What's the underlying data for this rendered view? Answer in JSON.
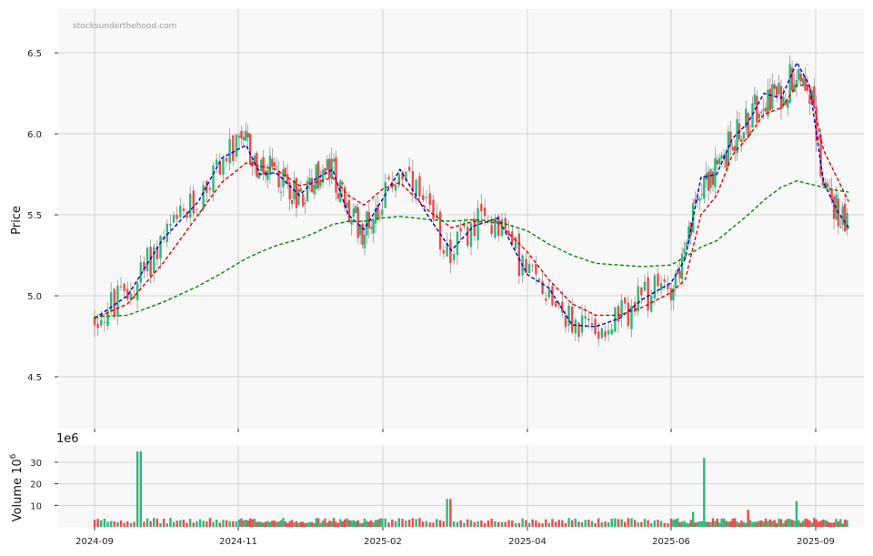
{
  "watermark": "stocksunderthehood.com",
  "chart_data": [
    {
      "type": "candlestick",
      "ylabel": "Price",
      "ylim": [
        4.18,
        6.77
      ],
      "yticks": [
        4.5,
        5.0,
        5.5,
        6.0,
        6.5
      ],
      "ytick_labels": [
        "4.5",
        "5.0",
        "5.5",
        "6.0",
        "6.5"
      ],
      "grid": true,
      "up_color": "#2db87a",
      "down_color": "#ef4a4a",
      "series": [
        {
          "style": "dashed",
          "color": "#0000cc",
          "points": [
            [
              "2024-09-01",
              4.86
            ],
            [
              "2024-09-15",
              5.0
            ],
            [
              "2024-09-30",
              5.35
            ],
            [
              "2024-10-15",
              5.58
            ],
            [
              "2024-10-25",
              5.85
            ],
            [
              "2024-11-06",
              5.93
            ],
            [
              "2024-11-15",
              5.75
            ],
            [
              "2024-11-25",
              5.76
            ],
            [
              "2024-12-10",
              5.62
            ],
            [
              "2024-12-20",
              5.72
            ],
            [
              "2024-12-31",
              5.78
            ],
            [
              "2025-01-10",
              5.5
            ],
            [
              "2025-01-20",
              5.41
            ],
            [
              "2025-02-01",
              5.6
            ],
            [
              "2025-02-08",
              5.78
            ],
            [
              "2025-02-20",
              5.48
            ],
            [
              "2025-03-01",
              5.28
            ],
            [
              "2025-03-10",
              5.43
            ],
            [
              "2025-03-20",
              5.48
            ],
            [
              "2025-04-01",
              5.13
            ],
            [
              "2025-04-10",
              5.05
            ],
            [
              "2025-04-20",
              4.82
            ],
            [
              "2025-04-30",
              4.81
            ],
            [
              "2025-05-10",
              4.86
            ],
            [
              "2025-05-20",
              4.98
            ],
            [
              "2025-06-01",
              5.08
            ],
            [
              "2025-06-10",
              5.23
            ],
            [
              "2025-06-20",
              5.73
            ],
            [
              "2025-06-30",
              5.75
            ],
            [
              "2025-07-10",
              5.97
            ],
            [
              "2025-07-20",
              6.07
            ],
            [
              "2025-07-30",
              6.25
            ],
            [
              "2025-08-10",
              6.22
            ],
            [
              "2025-08-20",
              6.44
            ],
            [
              "2025-08-28",
              6.3
            ],
            [
              "2025-09-06",
              5.7
            ],
            [
              "2025-09-15",
              5.52
            ],
            [
              "2025-09-22",
              5.42
            ]
          ]
        },
        {
          "style": "dashed",
          "color": "#e00000",
          "points": [
            [
              "2024-09-01",
              4.86
            ],
            [
              "2024-09-15",
              4.95
            ],
            [
              "2024-09-30",
              5.2
            ],
            [
              "2024-10-15",
              5.5
            ],
            [
              "2024-10-25",
              5.7
            ],
            [
              "2024-11-06",
              5.82
            ],
            [
              "2024-11-15",
              5.8
            ],
            [
              "2024-11-25",
              5.78
            ],
            [
              "2024-12-10",
              5.68
            ],
            [
              "2024-12-20",
              5.7
            ],
            [
              "2024-12-31",
              5.73
            ],
            [
              "2025-01-10",
              5.62
            ],
            [
              "2025-01-20",
              5.56
            ],
            [
              "2025-02-01",
              5.66
            ],
            [
              "2025-02-08",
              5.7
            ],
            [
              "2025-02-20",
              5.52
            ],
            [
              "2025-03-01",
              5.42
            ],
            [
              "2025-03-10",
              5.46
            ],
            [
              "2025-03-20",
              5.45
            ],
            [
              "2025-04-01",
              5.27
            ],
            [
              "2025-04-10",
              5.1
            ],
            [
              "2025-04-20",
              4.95
            ],
            [
              "2025-04-30",
              4.88
            ],
            [
              "2025-05-10",
              4.88
            ],
            [
              "2025-05-20",
              4.93
            ],
            [
              "2025-06-01",
              5.02
            ],
            [
              "2025-06-10",
              5.1
            ],
            [
              "2025-06-20",
              5.5
            ],
            [
              "2025-06-30",
              5.62
            ],
            [
              "2025-07-10",
              5.87
            ],
            [
              "2025-07-20",
              5.98
            ],
            [
              "2025-07-30",
              6.12
            ],
            [
              "2025-08-10",
              6.16
            ],
            [
              "2025-08-20",
              6.3
            ],
            [
              "2025-08-28",
              6.3
            ],
            [
              "2025-09-06",
              5.9
            ],
            [
              "2025-09-15",
              5.72
            ],
            [
              "2025-09-22",
              5.58
            ]
          ]
        },
        {
          "style": "dashed",
          "color": "#008800",
          "points": [
            [
              "2024-09-01",
              4.87
            ],
            [
              "2024-09-15",
              4.88
            ],
            [
              "2024-09-30",
              4.96
            ],
            [
              "2024-10-15",
              5.06
            ],
            [
              "2024-10-25",
              5.14
            ],
            [
              "2024-11-06",
              5.23
            ],
            [
              "2024-11-15",
              5.27
            ],
            [
              "2024-11-25",
              5.31
            ],
            [
              "2024-12-10",
              5.35
            ],
            [
              "2024-12-20",
              5.39
            ],
            [
              "2024-12-31",
              5.44
            ],
            [
              "2025-01-10",
              5.46
            ],
            [
              "2025-01-20",
              5.46
            ],
            [
              "2025-02-01",
              5.48
            ],
            [
              "2025-02-08",
              5.49
            ],
            [
              "2025-02-20",
              5.47
            ],
            [
              "2025-03-01",
              5.46
            ],
            [
              "2025-03-10",
              5.47
            ],
            [
              "2025-03-20",
              5.46
            ],
            [
              "2025-04-01",
              5.4
            ],
            [
              "2025-04-10",
              5.32
            ],
            [
              "2025-04-20",
              5.25
            ],
            [
              "2025-04-30",
              5.2
            ],
            [
              "2025-05-10",
              5.19
            ],
            [
              "2025-05-20",
              5.18
            ],
            [
              "2025-06-01",
              5.19
            ],
            [
              "2025-06-10",
              5.24
            ],
            [
              "2025-06-20",
              5.3
            ],
            [
              "2025-06-30",
              5.34
            ],
            [
              "2025-07-10",
              5.42
            ],
            [
              "2025-07-20",
              5.5
            ],
            [
              "2025-07-30",
              5.59
            ],
            [
              "2025-08-10",
              5.67
            ],
            [
              "2025-08-20",
              5.71
            ],
            [
              "2025-08-28",
              5.69
            ],
            [
              "2025-09-06",
              5.67
            ],
            [
              "2025-09-15",
              5.65
            ],
            [
              "2025-09-22",
              5.64
            ]
          ]
        }
      ]
    },
    {
      "type": "bar",
      "ylabel": "Volume  10",
      "ylabel_exponent": "6",
      "offset_label": "1e6",
      "ylim": [
        0,
        38
      ],
      "yticks": [
        10,
        20,
        30
      ],
      "ytick_labels": [
        "10",
        "20",
        "30"
      ],
      "grid": true,
      "up_color": "#2db87a",
      "down_color": "#ef4a4a",
      "spikes": [
        [
          "2024-09-20",
          35
        ],
        [
          "2025-02-28",
          13
        ],
        [
          "2025-06-15",
          7
        ],
        [
          "2025-06-22",
          32
        ],
        [
          "2025-07-20",
          8
        ],
        [
          "2025-08-20",
          12
        ]
      ]
    }
  ],
  "x_axis": {
    "ticks": [
      "2024-09-01",
      "2024-11-01",
      "2025-02-01",
      "2025-04-01",
      "2025-06-01",
      "2025-09-01"
    ],
    "tick_labels": [
      "2024-09",
      "2024-11",
      "2025-02",
      "2025-04",
      "2025-06",
      "2025-09"
    ]
  }
}
